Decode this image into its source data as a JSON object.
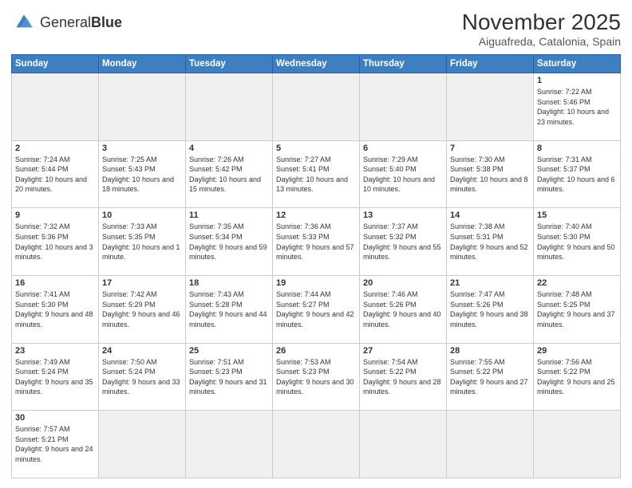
{
  "logo": {
    "text_general": "General",
    "text_blue": "Blue"
  },
  "header": {
    "month": "November 2025",
    "location": "Aiguafreda, Catalonia, Spain"
  },
  "days_of_week": [
    "Sunday",
    "Monday",
    "Tuesday",
    "Wednesday",
    "Thursday",
    "Friday",
    "Saturday"
  ],
  "weeks": [
    [
      {
        "day": "",
        "info": ""
      },
      {
        "day": "",
        "info": ""
      },
      {
        "day": "",
        "info": ""
      },
      {
        "day": "",
        "info": ""
      },
      {
        "day": "",
        "info": ""
      },
      {
        "day": "",
        "info": ""
      },
      {
        "day": "1",
        "info": "Sunrise: 7:22 AM\nSunset: 5:46 PM\nDaylight: 10 hours\nand 23 minutes."
      }
    ],
    [
      {
        "day": "2",
        "info": "Sunrise: 7:24 AM\nSunset: 5:44 PM\nDaylight: 10 hours\nand 20 minutes."
      },
      {
        "day": "3",
        "info": "Sunrise: 7:25 AM\nSunset: 5:43 PM\nDaylight: 10 hours\nand 18 minutes."
      },
      {
        "day": "4",
        "info": "Sunrise: 7:26 AM\nSunset: 5:42 PM\nDaylight: 10 hours\nand 15 minutes."
      },
      {
        "day": "5",
        "info": "Sunrise: 7:27 AM\nSunset: 5:41 PM\nDaylight: 10 hours\nand 13 minutes."
      },
      {
        "day": "6",
        "info": "Sunrise: 7:29 AM\nSunset: 5:40 PM\nDaylight: 10 hours\nand 10 minutes."
      },
      {
        "day": "7",
        "info": "Sunrise: 7:30 AM\nSunset: 5:38 PM\nDaylight: 10 hours\nand 8 minutes."
      },
      {
        "day": "8",
        "info": "Sunrise: 7:31 AM\nSunset: 5:37 PM\nDaylight: 10 hours\nand 6 minutes."
      }
    ],
    [
      {
        "day": "9",
        "info": "Sunrise: 7:32 AM\nSunset: 5:36 PM\nDaylight: 10 hours\nand 3 minutes."
      },
      {
        "day": "10",
        "info": "Sunrise: 7:33 AM\nSunset: 5:35 PM\nDaylight: 10 hours\nand 1 minute."
      },
      {
        "day": "11",
        "info": "Sunrise: 7:35 AM\nSunset: 5:34 PM\nDaylight: 9 hours\nand 59 minutes."
      },
      {
        "day": "12",
        "info": "Sunrise: 7:36 AM\nSunset: 5:33 PM\nDaylight: 9 hours\nand 57 minutes."
      },
      {
        "day": "13",
        "info": "Sunrise: 7:37 AM\nSunset: 5:32 PM\nDaylight: 9 hours\nand 55 minutes."
      },
      {
        "day": "14",
        "info": "Sunrise: 7:38 AM\nSunset: 5:31 PM\nDaylight: 9 hours\nand 52 minutes."
      },
      {
        "day": "15",
        "info": "Sunrise: 7:40 AM\nSunset: 5:30 PM\nDaylight: 9 hours\nand 50 minutes."
      }
    ],
    [
      {
        "day": "16",
        "info": "Sunrise: 7:41 AM\nSunset: 5:30 PM\nDaylight: 9 hours\nand 48 minutes."
      },
      {
        "day": "17",
        "info": "Sunrise: 7:42 AM\nSunset: 5:29 PM\nDaylight: 9 hours\nand 46 minutes."
      },
      {
        "day": "18",
        "info": "Sunrise: 7:43 AM\nSunset: 5:28 PM\nDaylight: 9 hours\nand 44 minutes."
      },
      {
        "day": "19",
        "info": "Sunrise: 7:44 AM\nSunset: 5:27 PM\nDaylight: 9 hours\nand 42 minutes."
      },
      {
        "day": "20",
        "info": "Sunrise: 7:46 AM\nSunset: 5:26 PM\nDaylight: 9 hours\nand 40 minutes."
      },
      {
        "day": "21",
        "info": "Sunrise: 7:47 AM\nSunset: 5:26 PM\nDaylight: 9 hours\nand 38 minutes."
      },
      {
        "day": "22",
        "info": "Sunrise: 7:48 AM\nSunset: 5:25 PM\nDaylight: 9 hours\nand 37 minutes."
      }
    ],
    [
      {
        "day": "23",
        "info": "Sunrise: 7:49 AM\nSunset: 5:24 PM\nDaylight: 9 hours\nand 35 minutes."
      },
      {
        "day": "24",
        "info": "Sunrise: 7:50 AM\nSunset: 5:24 PM\nDaylight: 9 hours\nand 33 minutes."
      },
      {
        "day": "25",
        "info": "Sunrise: 7:51 AM\nSunset: 5:23 PM\nDaylight: 9 hours\nand 31 minutes."
      },
      {
        "day": "26",
        "info": "Sunrise: 7:53 AM\nSunset: 5:23 PM\nDaylight: 9 hours\nand 30 minutes."
      },
      {
        "day": "27",
        "info": "Sunrise: 7:54 AM\nSunset: 5:22 PM\nDaylight: 9 hours\nand 28 minutes."
      },
      {
        "day": "28",
        "info": "Sunrise: 7:55 AM\nSunset: 5:22 PM\nDaylight: 9 hours\nand 27 minutes."
      },
      {
        "day": "29",
        "info": "Sunrise: 7:56 AM\nSunset: 5:22 PM\nDaylight: 9 hours\nand 25 minutes."
      }
    ],
    [
      {
        "day": "30",
        "info": "Sunrise: 7:57 AM\nSunset: 5:21 PM\nDaylight: 9 hours\nand 24 minutes."
      },
      {
        "day": "",
        "info": ""
      },
      {
        "day": "",
        "info": ""
      },
      {
        "day": "",
        "info": ""
      },
      {
        "day": "",
        "info": ""
      },
      {
        "day": "",
        "info": ""
      },
      {
        "day": "",
        "info": ""
      }
    ]
  ]
}
